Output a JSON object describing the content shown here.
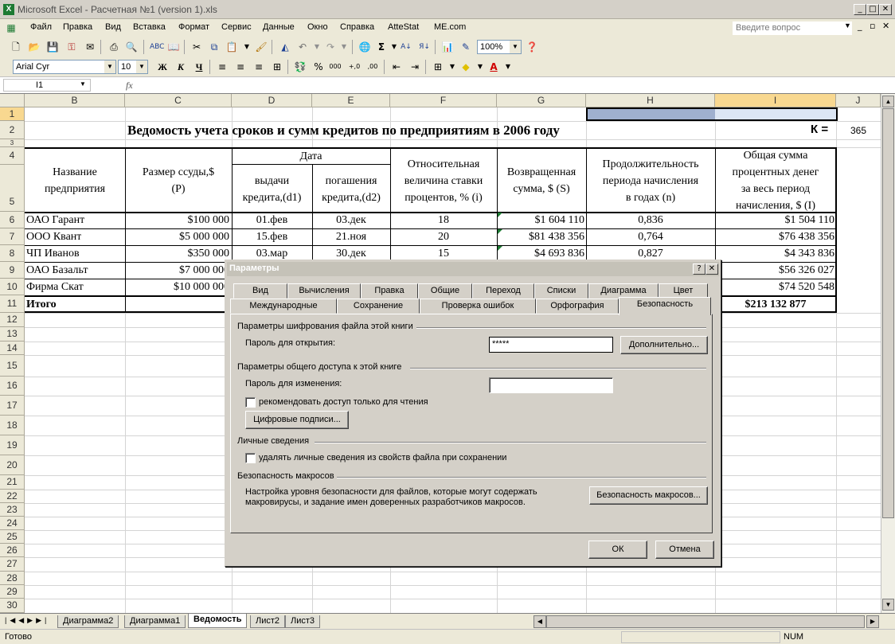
{
  "window": {
    "title": "Microsoft Excel - Расчетная №1 (version 1).xls",
    "app_icon": "X"
  },
  "menu": {
    "items": [
      "Файл",
      "Правка",
      "Вид",
      "Вставка",
      "Формат",
      "Сервис",
      "Данные",
      "Окно",
      "Справка",
      "AtteStat",
      "ME.com"
    ],
    "help_placeholder": "Введите вопрос"
  },
  "toolbar": {
    "zoom": "100%",
    "font": "Arial Cyr",
    "size": "10",
    "bold": "Ж",
    "italic": "К",
    "underline": "Ч",
    "percent": "%",
    "thousands": "000"
  },
  "formula_bar": {
    "name_box": "I1",
    "fx": "fx",
    "value": ""
  },
  "columns": [
    "B",
    "C",
    "D",
    "E",
    "F",
    "G",
    "H",
    "I",
    "J"
  ],
  "rows": [
    "1",
    "2",
    "3",
    "4",
    "5",
    "6",
    "7",
    "8",
    "9",
    "10",
    "11",
    "12",
    "13",
    "14",
    "15",
    "16",
    "17",
    "18",
    "19",
    "20",
    "21",
    "22",
    "23",
    "24",
    "25",
    "26",
    "27",
    "28",
    "29",
    "30"
  ],
  "sheet": {
    "title": "Ведомость учета сроков и сумм кредитов по предприятиям в 2006 году",
    "k_label": "К =",
    "k_value": "365",
    "headers": {
      "name": [
        "Название",
        "предприятия"
      ],
      "loan": [
        "Размер ссуды,$",
        "(P)"
      ],
      "date": "Дата",
      "issue": [
        "выдачи",
        "кредита,(d1)"
      ],
      "repay": [
        "погашения",
        "кредита,(d2)"
      ],
      "rate": [
        "Относительная",
        "величина ставки",
        "процентов, % (i)"
      ],
      "returned": [
        "Возвращенная",
        "сумма, $ (S)"
      ],
      "period": [
        "Продолжительность",
        "периода начисления",
        "в годах (n)"
      ],
      "interest": [
        "Общая сумма",
        "процентных денег",
        "за весь период",
        "начисления, $ (I)"
      ]
    },
    "data": [
      {
        "name": "ОАО Гарант",
        "loan": "$100 000",
        "d1": "01.фев",
        "d2": "03.дек",
        "rate": "18",
        "s": "$1 604 110",
        "n": "0,836",
        "i": "$1 504 110"
      },
      {
        "name": "ООО Квант",
        "loan": "$5 000 000",
        "d1": "15.фев",
        "d2": "21.ноя",
        "rate": "20",
        "s": "$81 438 356",
        "n": "0,764",
        "i": "$76 438 356"
      },
      {
        "name": "ЧП Иванов",
        "loan": "$350 000",
        "d1": "03.мар",
        "d2": "30.дек",
        "rate": "15",
        "s": "$4 693 836",
        "n": "0,827",
        "i": "$4 343 836"
      },
      {
        "name": "ОАО Базальт",
        "loan": "$7 000 000",
        "d1": "",
        "d2": "",
        "rate": "",
        "s": "",
        "n": "",
        "i": "$56 326 027"
      },
      {
        "name": "Фирма Скат",
        "loan": "$10 000 000",
        "d1": "",
        "d2": "",
        "rate": "",
        "s": "",
        "n": "",
        "i": "$74 520 548"
      }
    ],
    "total_label": "Итого",
    "total_value": "$213 132 877"
  },
  "sheet_tabs": [
    "Диаграмма2",
    "Диаграмма1",
    "Ведомость",
    "Лист2",
    "Лист3"
  ],
  "active_tab": "Ведомость",
  "status": {
    "ready": "Готово",
    "num": "NUM"
  },
  "dialog": {
    "title": "Параметры",
    "help": "?",
    "close": "✕",
    "tabs_row1": [
      "Вид",
      "Вычисления",
      "Правка",
      "Общие",
      "Переход",
      "Списки",
      "Диаграмма",
      "Цвет"
    ],
    "tabs_row2": [
      "Международные",
      "Сохранение",
      "Проверка ошибок",
      "Орфография",
      "Безопасность"
    ],
    "active_tab": "Безопасность",
    "encryption_group": "Параметры шифрования файла этой книги",
    "open_password_label": "Пароль для открытия:",
    "open_password_value": "*****",
    "advanced_button": "Дополнительно...",
    "sharing_group": "Параметры общего доступа к этой книге",
    "modify_password_label": "Пароль для изменения:",
    "modify_password_value": "",
    "readonly_checkbox": "рекомендовать доступ только для чтения",
    "digital_sign_button": "Цифровые подписи...",
    "personal_group": "Личные сведения",
    "remove_personal_checkbox": "удалять личные сведения из свойств файла при сохранении",
    "macro_group": "Безопасность макросов",
    "macro_text": [
      "Настройка уровня безопасности для файлов, которые могут содержать",
      "макровирусы, и задание имен доверенных разработчиков макросов."
    ],
    "macro_button": "Безопасность макросов...",
    "ok": "ОК",
    "cancel": "Отмена"
  }
}
